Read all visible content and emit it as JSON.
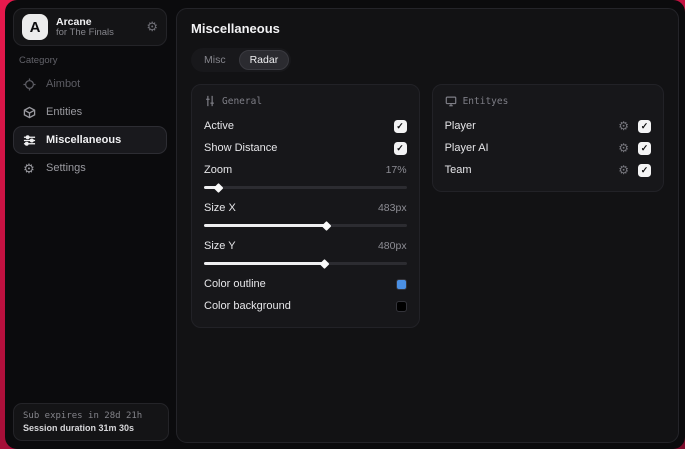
{
  "glyphs": {
    "check": "✓",
    "gear": "⚙"
  },
  "colors": {
    "accent_red": "#c01140",
    "outline_swatch": "#4a8fe3",
    "background_swatch": "#000000"
  },
  "sidebar": {
    "app": {
      "name": "Arcane",
      "subtitle": "for The Finals",
      "logo_letter": "A"
    },
    "category_label": "Category",
    "items": [
      {
        "label": "Aimbot",
        "icon": "crosshair-icon",
        "active": false
      },
      {
        "label": "Entities",
        "icon": "cube-icon",
        "active": false
      },
      {
        "label": "Miscellaneous",
        "icon": "sliders-icon",
        "active": true
      },
      {
        "label": "Settings",
        "icon": "gear-icon",
        "active": false
      }
    ],
    "footer": {
      "sub_expires": "Sub expires in 28d 21h",
      "session_duration": "Session duration 31m 30s"
    }
  },
  "main": {
    "title": "Miscellaneous",
    "tabs": [
      {
        "label": "Misc",
        "active": false
      },
      {
        "label": "Radar",
        "active": true
      }
    ],
    "general_panel": {
      "title": "General",
      "toggles": [
        {
          "label": "Active",
          "checked": true
        },
        {
          "label": "Show Distance",
          "checked": true
        }
      ],
      "sliders": [
        {
          "label": "Zoom",
          "value": "17%",
          "fill_pct": 7
        },
        {
          "label": "Size X",
          "value": "483px",
          "fill_pct": 60
        },
        {
          "label": "Size Y",
          "value": "480px",
          "fill_pct": 59
        }
      ],
      "swatches": [
        {
          "label": "Color outline",
          "color": "#4a8fe3"
        },
        {
          "label": "Color background",
          "color": "#000000"
        }
      ]
    },
    "entities_panel": {
      "title": "Entityes",
      "rows": [
        {
          "label": "Player",
          "checked": true
        },
        {
          "label": "Player AI",
          "checked": true
        },
        {
          "label": "Team",
          "checked": true
        }
      ]
    }
  }
}
